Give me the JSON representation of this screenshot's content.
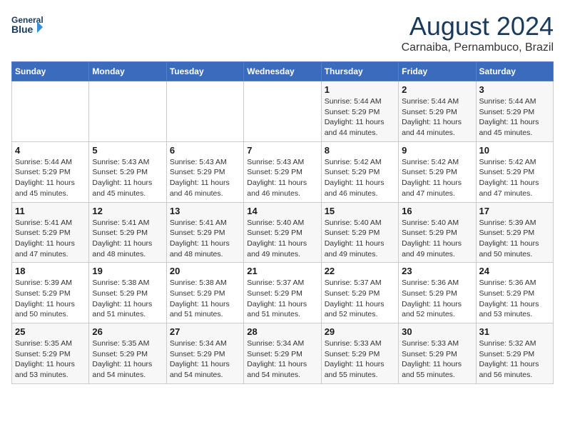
{
  "header": {
    "logo_line1": "General",
    "logo_line2": "Blue",
    "month": "August 2024",
    "location": "Carnaiba, Pernambuco, Brazil"
  },
  "weekdays": [
    "Sunday",
    "Monday",
    "Tuesday",
    "Wednesday",
    "Thursday",
    "Friday",
    "Saturday"
  ],
  "weeks": [
    [
      {
        "day": "",
        "info": ""
      },
      {
        "day": "",
        "info": ""
      },
      {
        "day": "",
        "info": ""
      },
      {
        "day": "",
        "info": ""
      },
      {
        "day": "1",
        "info": "Sunrise: 5:44 AM\nSunset: 5:29 PM\nDaylight: 11 hours\nand 44 minutes."
      },
      {
        "day": "2",
        "info": "Sunrise: 5:44 AM\nSunset: 5:29 PM\nDaylight: 11 hours\nand 44 minutes."
      },
      {
        "day": "3",
        "info": "Sunrise: 5:44 AM\nSunset: 5:29 PM\nDaylight: 11 hours\nand 45 minutes."
      }
    ],
    [
      {
        "day": "4",
        "info": "Sunrise: 5:44 AM\nSunset: 5:29 PM\nDaylight: 11 hours\nand 45 minutes."
      },
      {
        "day": "5",
        "info": "Sunrise: 5:43 AM\nSunset: 5:29 PM\nDaylight: 11 hours\nand 45 minutes."
      },
      {
        "day": "6",
        "info": "Sunrise: 5:43 AM\nSunset: 5:29 PM\nDaylight: 11 hours\nand 46 minutes."
      },
      {
        "day": "7",
        "info": "Sunrise: 5:43 AM\nSunset: 5:29 PM\nDaylight: 11 hours\nand 46 minutes."
      },
      {
        "day": "8",
        "info": "Sunrise: 5:42 AM\nSunset: 5:29 PM\nDaylight: 11 hours\nand 46 minutes."
      },
      {
        "day": "9",
        "info": "Sunrise: 5:42 AM\nSunset: 5:29 PM\nDaylight: 11 hours\nand 47 minutes."
      },
      {
        "day": "10",
        "info": "Sunrise: 5:42 AM\nSunset: 5:29 PM\nDaylight: 11 hours\nand 47 minutes."
      }
    ],
    [
      {
        "day": "11",
        "info": "Sunrise: 5:41 AM\nSunset: 5:29 PM\nDaylight: 11 hours\nand 47 minutes."
      },
      {
        "day": "12",
        "info": "Sunrise: 5:41 AM\nSunset: 5:29 PM\nDaylight: 11 hours\nand 48 minutes."
      },
      {
        "day": "13",
        "info": "Sunrise: 5:41 AM\nSunset: 5:29 PM\nDaylight: 11 hours\nand 48 minutes."
      },
      {
        "day": "14",
        "info": "Sunrise: 5:40 AM\nSunset: 5:29 PM\nDaylight: 11 hours\nand 49 minutes."
      },
      {
        "day": "15",
        "info": "Sunrise: 5:40 AM\nSunset: 5:29 PM\nDaylight: 11 hours\nand 49 minutes."
      },
      {
        "day": "16",
        "info": "Sunrise: 5:40 AM\nSunset: 5:29 PM\nDaylight: 11 hours\nand 49 minutes."
      },
      {
        "day": "17",
        "info": "Sunrise: 5:39 AM\nSunset: 5:29 PM\nDaylight: 11 hours\nand 50 minutes."
      }
    ],
    [
      {
        "day": "18",
        "info": "Sunrise: 5:39 AM\nSunset: 5:29 PM\nDaylight: 11 hours\nand 50 minutes."
      },
      {
        "day": "19",
        "info": "Sunrise: 5:38 AM\nSunset: 5:29 PM\nDaylight: 11 hours\nand 51 minutes."
      },
      {
        "day": "20",
        "info": "Sunrise: 5:38 AM\nSunset: 5:29 PM\nDaylight: 11 hours\nand 51 minutes."
      },
      {
        "day": "21",
        "info": "Sunrise: 5:37 AM\nSunset: 5:29 PM\nDaylight: 11 hours\nand 51 minutes."
      },
      {
        "day": "22",
        "info": "Sunrise: 5:37 AM\nSunset: 5:29 PM\nDaylight: 11 hours\nand 52 minutes."
      },
      {
        "day": "23",
        "info": "Sunrise: 5:36 AM\nSunset: 5:29 PM\nDaylight: 11 hours\nand 52 minutes."
      },
      {
        "day": "24",
        "info": "Sunrise: 5:36 AM\nSunset: 5:29 PM\nDaylight: 11 hours\nand 53 minutes."
      }
    ],
    [
      {
        "day": "25",
        "info": "Sunrise: 5:35 AM\nSunset: 5:29 PM\nDaylight: 11 hours\nand 53 minutes."
      },
      {
        "day": "26",
        "info": "Sunrise: 5:35 AM\nSunset: 5:29 PM\nDaylight: 11 hours\nand 54 minutes."
      },
      {
        "day": "27",
        "info": "Sunrise: 5:34 AM\nSunset: 5:29 PM\nDaylight: 11 hours\nand 54 minutes."
      },
      {
        "day": "28",
        "info": "Sunrise: 5:34 AM\nSunset: 5:29 PM\nDaylight: 11 hours\nand 54 minutes."
      },
      {
        "day": "29",
        "info": "Sunrise: 5:33 AM\nSunset: 5:29 PM\nDaylight: 11 hours\nand 55 minutes."
      },
      {
        "day": "30",
        "info": "Sunrise: 5:33 AM\nSunset: 5:29 PM\nDaylight: 11 hours\nand 55 minutes."
      },
      {
        "day": "31",
        "info": "Sunrise: 5:32 AM\nSunset: 5:29 PM\nDaylight: 11 hours\nand 56 minutes."
      }
    ]
  ]
}
